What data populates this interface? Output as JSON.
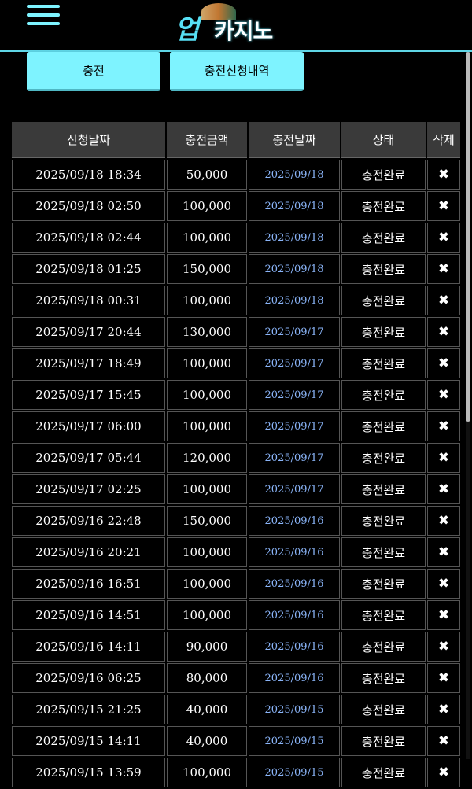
{
  "header": {
    "logo_mark": "업",
    "logo_text": "카지노"
  },
  "buttons": {
    "charge": "충전",
    "history": "충전신청내역"
  },
  "table": {
    "headers": [
      "신청날짜",
      "충전금액",
      "충전날짜",
      "상태",
      "삭제"
    ],
    "delete_glyph": "✖",
    "rows": [
      {
        "req": "2025/09/18 18:34",
        "amount": "50,000",
        "date": "2025/09/18",
        "status": "충전완료"
      },
      {
        "req": "2025/09/18 02:50",
        "amount": "100,000",
        "date": "2025/09/18",
        "status": "충전완료"
      },
      {
        "req": "2025/09/18 02:44",
        "amount": "100,000",
        "date": "2025/09/18",
        "status": "충전완료"
      },
      {
        "req": "2025/09/18 01:25",
        "amount": "150,000",
        "date": "2025/09/18",
        "status": "충전완료"
      },
      {
        "req": "2025/09/18 00:31",
        "amount": "100,000",
        "date": "2025/09/18",
        "status": "충전완료"
      },
      {
        "req": "2025/09/17 20:44",
        "amount": "130,000",
        "date": "2025/09/17",
        "status": "충전완료"
      },
      {
        "req": "2025/09/17 18:49",
        "amount": "100,000",
        "date": "2025/09/17",
        "status": "충전완료"
      },
      {
        "req": "2025/09/17 15:45",
        "amount": "100,000",
        "date": "2025/09/17",
        "status": "충전완료"
      },
      {
        "req": "2025/09/17 06:00",
        "amount": "100,000",
        "date": "2025/09/17",
        "status": "충전완료"
      },
      {
        "req": "2025/09/17 05:44",
        "amount": "120,000",
        "date": "2025/09/17",
        "status": "충전완료"
      },
      {
        "req": "2025/09/17 02:25",
        "amount": "100,000",
        "date": "2025/09/17",
        "status": "충전완료"
      },
      {
        "req": "2025/09/16 22:48",
        "amount": "150,000",
        "date": "2025/09/16",
        "status": "충전완료"
      },
      {
        "req": "2025/09/16 20:21",
        "amount": "100,000",
        "date": "2025/09/16",
        "status": "충전완료"
      },
      {
        "req": "2025/09/16 16:51",
        "amount": "100,000",
        "date": "2025/09/16",
        "status": "충전완료"
      },
      {
        "req": "2025/09/16 14:51",
        "amount": "100,000",
        "date": "2025/09/16",
        "status": "충전완료"
      },
      {
        "req": "2025/09/16 14:11",
        "amount": "90,000",
        "date": "2025/09/16",
        "status": "충전완료"
      },
      {
        "req": "2025/09/16 06:25",
        "amount": "80,000",
        "date": "2025/09/16",
        "status": "충전완료"
      },
      {
        "req": "2025/09/15 21:25",
        "amount": "40,000",
        "date": "2025/09/15",
        "status": "충전완료"
      },
      {
        "req": "2025/09/15 14:11",
        "amount": "40,000",
        "date": "2025/09/15",
        "status": "충전완료"
      },
      {
        "req": "2025/09/15 13:59",
        "amount": "100,000",
        "date": "2025/09/15",
        "status": "충전완료"
      }
    ]
  },
  "colors": {
    "accent": "#7ef3ff",
    "link": "#8ab4f8",
    "header_bg": "#3a3a3a"
  }
}
